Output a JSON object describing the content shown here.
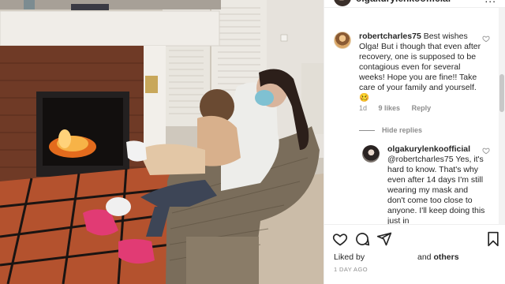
{
  "post": {
    "author": "olgakurylenkoofficial",
    "more_label": "..."
  },
  "comments": [
    {
      "username": "robertcharles75",
      "text": "Best wishes Olga! But i though that even after recovery, one is supposed to be contagious even for several weeks! Hope you are fine!! Take care of your family and yourself. 🥴",
      "time": "1d",
      "likes": "9 likes",
      "reply_label": "Reply",
      "hide_replies_label": "Hide replies"
    },
    {
      "username": "olgakurylenkoofficial",
      "text": "@robertcharles75 Yes, it's hard to know. That's why even after 14 days I'm still wearing my mask and don't come too close to anyone. I'll keep doing this just in"
    }
  ],
  "likes_line": {
    "prefix": "Liked by",
    "connector": "and",
    "others": "others"
  },
  "posted_ago": "1 DAY AGO",
  "icons": [
    "heart-icon",
    "comment-icon",
    "share-icon",
    "bookmark-icon"
  ],
  "colors": {
    "text": "#262626",
    "muted": "#8e8e8e",
    "border": "#efefef"
  }
}
